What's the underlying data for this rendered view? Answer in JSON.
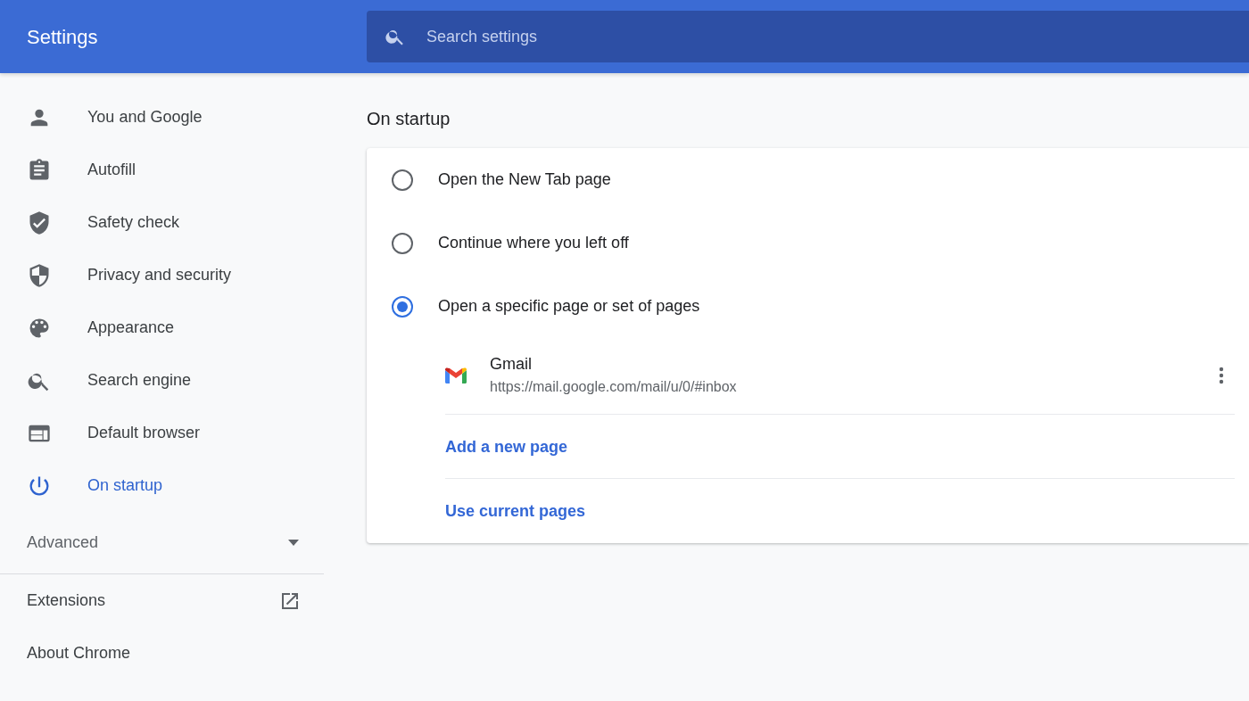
{
  "header": {
    "title": "Settings",
    "search": {
      "placeholder": "Search settings"
    }
  },
  "sidebar": {
    "items": [
      {
        "label": "You and Google",
        "selected": false
      },
      {
        "label": "Autofill",
        "selected": false
      },
      {
        "label": "Safety check",
        "selected": false
      },
      {
        "label": "Privacy and security",
        "selected": false
      },
      {
        "label": "Appearance",
        "selected": false
      },
      {
        "label": "Search engine",
        "selected": false
      },
      {
        "label": "Default browser",
        "selected": false
      },
      {
        "label": "On startup",
        "selected": true
      }
    ],
    "advanced": {
      "label": "Advanced",
      "expanded": false
    },
    "footer_links": [
      {
        "label": "Extensions",
        "kind": "external"
      },
      {
        "label": "About Chrome",
        "kind": "plain"
      }
    ]
  },
  "main": {
    "section_title": "On startup",
    "options": [
      {
        "label": "Open the New Tab page",
        "selected": false
      },
      {
        "label": "Continue where you left off",
        "selected": false
      },
      {
        "label": "Open a specific page or set of pages",
        "selected": true
      }
    ],
    "pages": [
      {
        "title": "Gmail",
        "url": "https://mail.google.com/mail/u/0/#inbox"
      }
    ],
    "links": [
      "Add a new page",
      "Use current pages"
    ]
  }
}
